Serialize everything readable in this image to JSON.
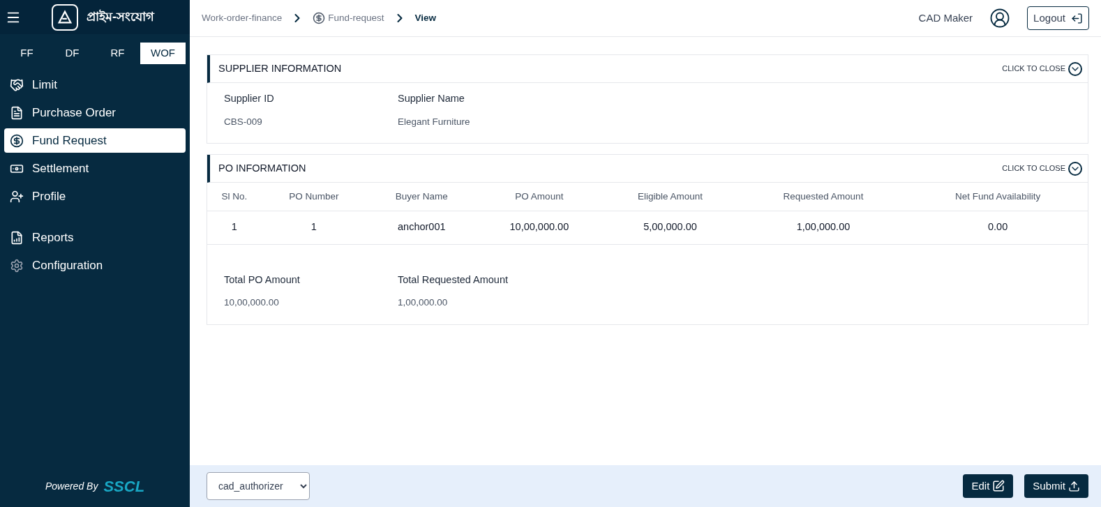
{
  "sidebar": {
    "logo_text": "প্রাইম-সংযোগ",
    "tabs": [
      {
        "label": "FF",
        "selected": false
      },
      {
        "label": "DF",
        "selected": false
      },
      {
        "label": "RF",
        "selected": false
      },
      {
        "label": "WOF",
        "selected": true
      }
    ],
    "items": [
      {
        "label": "Limit",
        "selected": false
      },
      {
        "label": "Purchase Order",
        "selected": false
      },
      {
        "label": "Fund Request",
        "selected": true
      },
      {
        "label": "Settlement",
        "selected": false
      },
      {
        "label": "Profile",
        "selected": false
      }
    ],
    "lower_items": [
      {
        "label": "Reports",
        "selected": false
      },
      {
        "label": "Configuration",
        "selected": false
      }
    ],
    "powered_by": "Powered By",
    "brand": "SSCL"
  },
  "header": {
    "breadcrumbs": [
      "Work-order-finance",
      "Fund-request",
      "View"
    ],
    "user": "CAD Maker",
    "logout": "Logout"
  },
  "supplier_section": {
    "title": "SUPPLIER INFORMATION",
    "toggle": "CLICK TO CLOSE",
    "expanded": true,
    "fields": [
      {
        "label": "Supplier ID",
        "value": "CBS-009"
      },
      {
        "label": "Supplier Name",
        "value": "Elegant Furniture"
      }
    ]
  },
  "po_section": {
    "title": "PO INFORMATION",
    "toggle": "CLICK TO CLOSE",
    "expanded": true,
    "table": {
      "columns": [
        "Sl No.",
        "PO Number",
        "Buyer Name",
        "PO Amount",
        "Eligible Amount",
        "Requested Amount",
        "Net Fund Availability"
      ],
      "rows": [
        [
          "1",
          "1",
          "anchor001",
          "10,00,000.00",
          "5,00,000.00",
          "1,00,000.00",
          "0.00"
        ]
      ]
    },
    "totals": [
      {
        "label": "Total PO Amount",
        "value": "10,00,000.00"
      },
      {
        "label": "Total Requested Amount",
        "value": "1,00,000.00"
      }
    ]
  },
  "footer": {
    "role_select": "cad_authorizer",
    "edit": "Edit",
    "submit": "Submit"
  }
}
